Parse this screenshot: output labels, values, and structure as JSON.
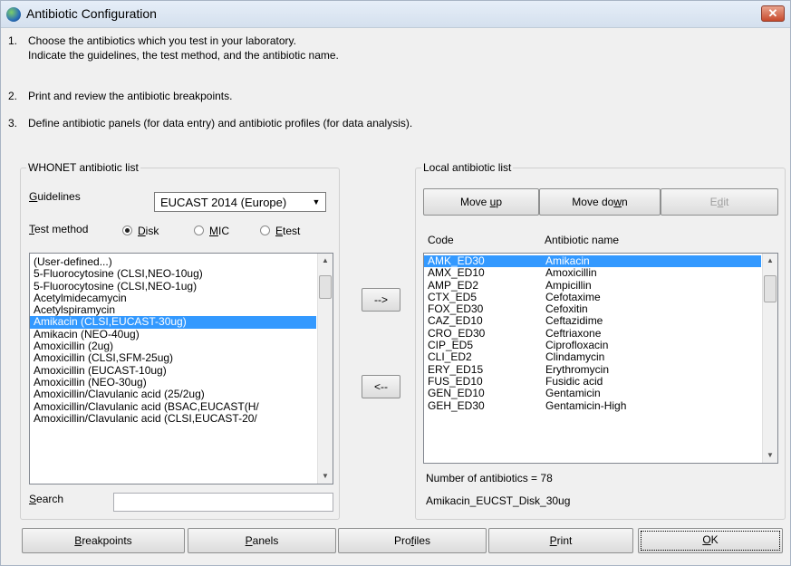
{
  "window": {
    "title": "Antibiotic Configuration",
    "close_glyph": "✕"
  },
  "steps": [
    {
      "num": "1.",
      "lines": [
        "Choose the antibiotics which you test in your laboratory.",
        "Indicate the guidelines, the test method, and the antibiotic name."
      ]
    },
    {
      "num": "2.",
      "lines": [
        "Print and review the antibiotic breakpoints."
      ]
    },
    {
      "num": "3.",
      "lines": [
        "Define antibiotic panels (for data entry) and antibiotic profiles (for data analysis)."
      ]
    }
  ],
  "whonet": {
    "group_label": "WHONET antibiotic list",
    "guidelines_label": "Guidelines",
    "guidelines_value": "EUCAST 2014 (Europe)",
    "test_method_label": "Test method",
    "methods": [
      {
        "label": "Disk",
        "checked": true
      },
      {
        "label": "MIC",
        "checked": false
      },
      {
        "label": "Etest",
        "checked": false
      }
    ],
    "items": [
      "(User-defined...)",
      "5-Fluorocytosine (CLSI,NEO-10ug)",
      "5-Fluorocytosine (CLSI,NEO-1ug)",
      "Acetylmidecamycin",
      "Acetylspiramycin",
      "Amikacin (CLSI,EUCAST-30ug)",
      "Amikacin (NEO-40ug)",
      "Amoxicillin (2ug)",
      "Amoxicillin (CLSI,SFM-25ug)",
      "Amoxicillin (EUCAST-10ug)",
      "Amoxicillin (NEO-30ug)",
      "Amoxicillin/Clavulanic acid (25/2ug)",
      "Amoxicillin/Clavulanic acid (BSAC,EUCAST(H/",
      "Amoxicillin/Clavulanic acid (CLSI,EUCAST-20/"
    ],
    "selected_index": 5,
    "search_label": "Search",
    "search_value": ""
  },
  "transfer": {
    "add": "-->",
    "remove": "<--"
  },
  "local": {
    "group_label": "Local antibiotic list",
    "move_up": "Move up",
    "move_down": "Move down",
    "edit": "Edit",
    "col_code": "Code",
    "col_name": "Antibiotic name",
    "rows": [
      {
        "code": "AMK_ED30",
        "name": "Amikacin"
      },
      {
        "code": "AMX_ED10",
        "name": "Amoxicillin"
      },
      {
        "code": "AMP_ED2",
        "name": "Ampicillin"
      },
      {
        "code": "CTX_ED5",
        "name": "Cefotaxime"
      },
      {
        "code": "FOX_ED30",
        "name": "Cefoxitin"
      },
      {
        "code": "CAZ_ED10",
        "name": "Ceftazidime"
      },
      {
        "code": "CRO_ED30",
        "name": "Ceftriaxone"
      },
      {
        "code": "CIP_ED5",
        "name": "Ciprofloxacin"
      },
      {
        "code": "CLI_ED2",
        "name": "Clindamycin"
      },
      {
        "code": "ERY_ED15",
        "name": "Erythromycin"
      },
      {
        "code": "FUS_ED10",
        "name": "Fusidic acid"
      },
      {
        "code": "GEN_ED10",
        "name": "Gentamicin"
      },
      {
        "code": "GEH_ED30",
        "name": "Gentamicin-High"
      }
    ],
    "selected_index": 0,
    "count_text": "Number of antibiotics = 78",
    "selected_desc": "Amikacin_EUCST_Disk_30ug"
  },
  "bottom": {
    "breakpoints": "Breakpoints",
    "panels": "Panels",
    "profiles": "Profiles",
    "print": "Print",
    "ok": "OK"
  }
}
